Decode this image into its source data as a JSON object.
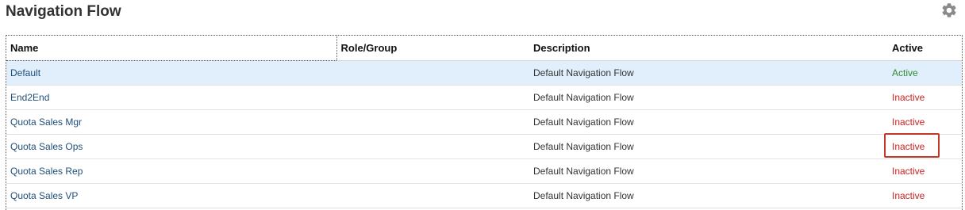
{
  "page": {
    "title": "Navigation Flow",
    "settings_icon": "gear-icon"
  },
  "table": {
    "columns": [
      "Name",
      "Role/Group",
      "Description",
      "Active"
    ],
    "rows": [
      {
        "name": "Default",
        "role": "",
        "description": "Default Navigation Flow",
        "status": "Active",
        "selected": true
      },
      {
        "name": "End2End",
        "role": "",
        "description": "Default Navigation Flow",
        "status": "Inactive",
        "selected": false
      },
      {
        "name": "Quota Sales Mgr",
        "role": "",
        "description": "Default Navigation Flow",
        "status": "Inactive",
        "selected": false
      },
      {
        "name": "Quota Sales Ops",
        "role": "",
        "description": "Default Navigation Flow",
        "status": "Inactive",
        "selected": false,
        "highlighted": true
      },
      {
        "name": "Quota Sales Rep",
        "role": "",
        "description": "Default Navigation Flow",
        "status": "Inactive",
        "selected": false
      },
      {
        "name": "Quota Sales VP",
        "role": "",
        "description": "Default Navigation Flow",
        "status": "Inactive",
        "selected": false
      }
    ]
  },
  "colors": {
    "title": "#333333",
    "link": "#1f4e79",
    "active": "#2f8a2f",
    "inactive": "#cc2222",
    "selected_row": "#e1eefb",
    "highlight_border": "#c0392b"
  }
}
